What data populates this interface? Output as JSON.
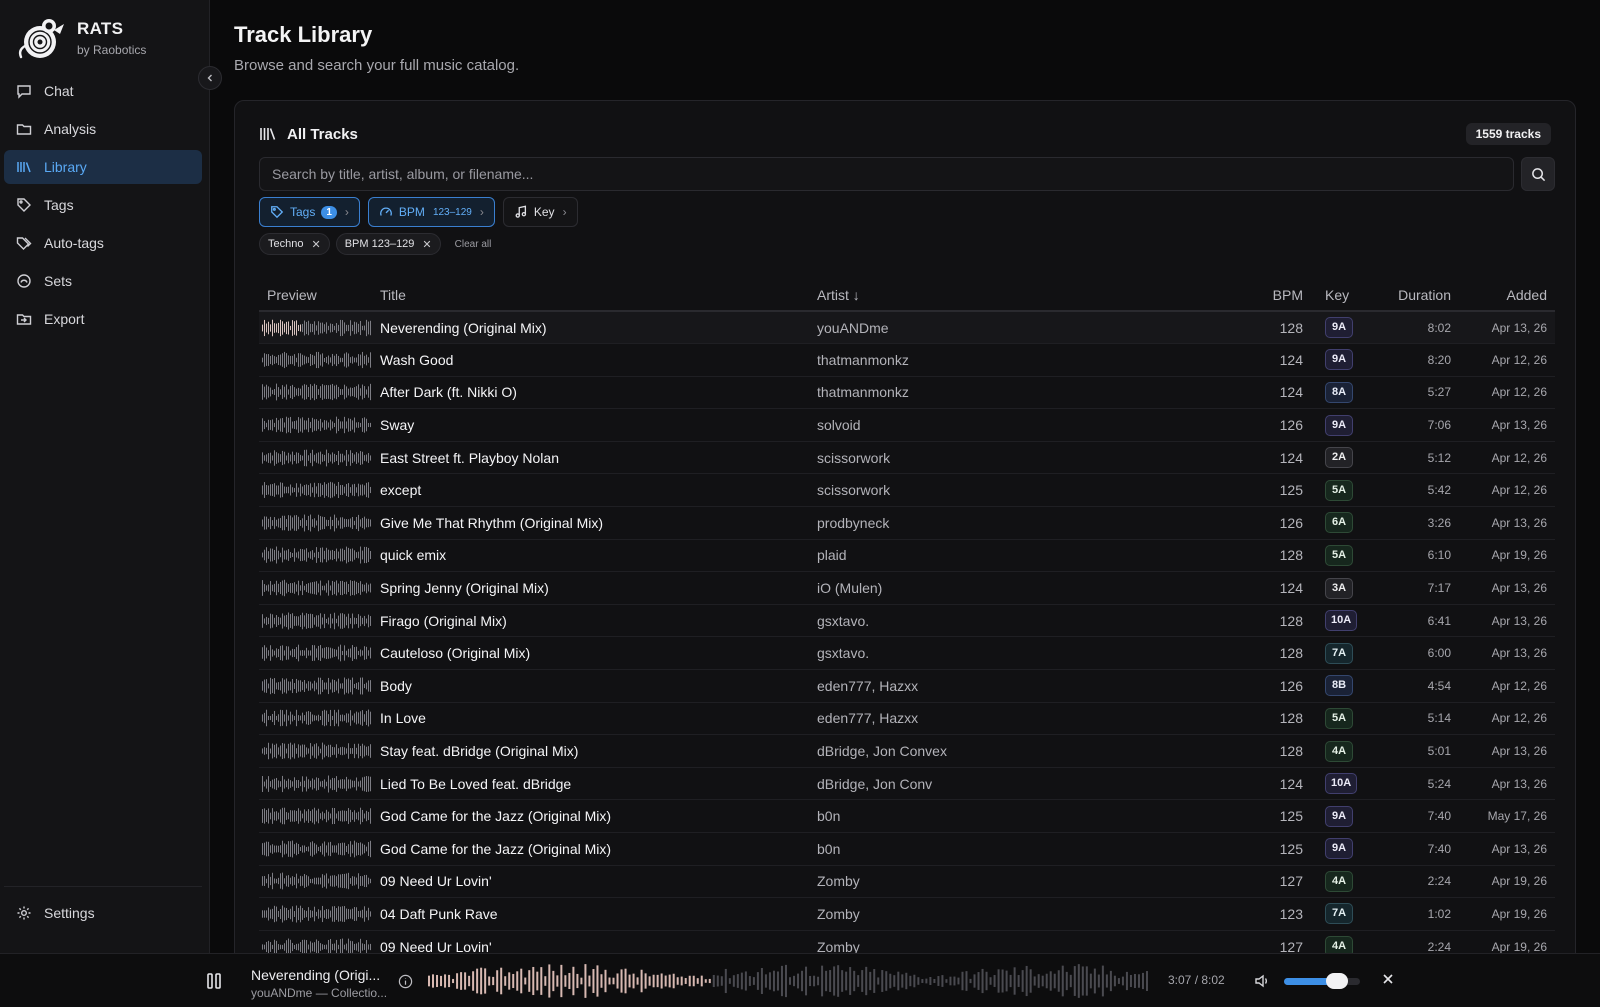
{
  "brand": {
    "name": "RATS",
    "sub": "by Raobotics"
  },
  "nav": [
    {
      "label": "Chat",
      "icon": "chat-icon",
      "active": false
    },
    {
      "label": "Analysis",
      "icon": "folder-icon",
      "active": false
    },
    {
      "label": "Library",
      "icon": "library-icon",
      "active": true
    },
    {
      "label": "Tags",
      "icon": "tag-icon",
      "active": false
    },
    {
      "label": "Auto-tags",
      "icon": "tags-icon",
      "active": false
    },
    {
      "label": "Sets",
      "icon": "sets-icon",
      "active": false
    },
    {
      "label": "Export",
      "icon": "export-icon",
      "active": false
    }
  ],
  "settings": {
    "label": "Settings",
    "icon": "gear-icon"
  },
  "page": {
    "title": "Track Library",
    "subtitle": "Browse and search your full music catalog."
  },
  "card": {
    "title": "All Tracks",
    "count": "1559 tracks",
    "search_placeholder": "Search by title, artist, album, or filename..."
  },
  "filters": {
    "tags": {
      "label": "Tags",
      "count": "1"
    },
    "bpm": {
      "label": "BPM",
      "range": "123–129"
    },
    "key": {
      "label": "Key"
    }
  },
  "chips": {
    "tag": "Techno",
    "bpm": "BPM 123–129",
    "clear": "Clear all"
  },
  "columns": {
    "preview": "Preview",
    "title": "Title",
    "artist": "Artist",
    "sort_indicator": "↓",
    "bpm": "BPM",
    "key": "Key",
    "duration": "Duration",
    "added": "Added"
  },
  "rows": [
    {
      "title": "Neverending (Original Mix)",
      "artist": "youANDme",
      "bpm": "128",
      "key": "9A",
      "duration": "8:02",
      "added": "Apr 13, 26"
    },
    {
      "title": "Wash Good",
      "artist": "thatmanmonkz",
      "bpm": "124",
      "key": "9A",
      "duration": "8:20",
      "added": "Apr 12, 26"
    },
    {
      "title": "After Dark (ft. Nikki O)",
      "artist": "thatmanmonkz",
      "bpm": "124",
      "key": "8A",
      "duration": "5:27",
      "added": "Apr 12, 26"
    },
    {
      "title": "Sway",
      "artist": "solvoid",
      "bpm": "126",
      "key": "9A",
      "duration": "7:06",
      "added": "Apr 13, 26"
    },
    {
      "title": "East Street ft. Playboy Nolan",
      "artist": "scissorwork",
      "bpm": "124",
      "key": "2A",
      "duration": "5:12",
      "added": "Apr 12, 26"
    },
    {
      "title": "except",
      "artist": "scissorwork",
      "bpm": "125",
      "key": "5A",
      "duration": "5:42",
      "added": "Apr 12, 26"
    },
    {
      "title": "Give Me That Rhythm (Original Mix)",
      "artist": "prodbyneck",
      "bpm": "126",
      "key": "6A",
      "duration": "3:26",
      "added": "Apr 13, 26"
    },
    {
      "title": "quick emix",
      "artist": "plaid",
      "bpm": "128",
      "key": "5A",
      "duration": "6:10",
      "added": "Apr 19, 26"
    },
    {
      "title": "Spring Jenny (Original Mix)",
      "artist": "iO (Mulen)",
      "bpm": "124",
      "key": "3A",
      "duration": "7:17",
      "added": "Apr 13, 26"
    },
    {
      "title": "Firago (Original Mix)",
      "artist": "gsxtavo.",
      "bpm": "128",
      "key": "10A",
      "duration": "6:41",
      "added": "Apr 13, 26"
    },
    {
      "title": "Cauteloso (Original Mix)",
      "artist": "gsxtavo.",
      "bpm": "128",
      "key": "7A",
      "duration": "6:00",
      "added": "Apr 13, 26"
    },
    {
      "title": "Body",
      "artist": "eden777, Hazxx",
      "bpm": "126",
      "key": "8B",
      "duration": "4:54",
      "added": "Apr 12, 26"
    },
    {
      "title": "In Love",
      "artist": "eden777, Hazxx",
      "bpm": "128",
      "key": "5A",
      "duration": "5:14",
      "added": "Apr 12, 26"
    },
    {
      "title": "Stay feat. dBridge (Original Mix)",
      "artist": "dBridge, Jon Convex",
      "bpm": "128",
      "key": "4A",
      "duration": "5:01",
      "added": "Apr 13, 26"
    },
    {
      "title": "Lied To Be Loved feat. dBridge",
      "artist": "dBridge, Jon Conv",
      "bpm": "124",
      "key": "10A",
      "duration": "5:24",
      "added": "Apr 13, 26"
    },
    {
      "title": "God Came for the Jazz (Original Mix)",
      "artist": "b0n",
      "bpm": "125",
      "key": "9A",
      "duration": "7:40",
      "added": "May 17, 26"
    },
    {
      "title": "God Came for the Jazz (Original Mix)",
      "artist": "b0n",
      "bpm": "125",
      "key": "9A",
      "duration": "7:40",
      "added": "Apr 13, 26"
    },
    {
      "title": "09 Need Ur Lovin'",
      "artist": "Zomby",
      "bpm": "127",
      "key": "4A",
      "duration": "2:24",
      "added": "Apr 19, 26"
    },
    {
      "title": "04 Daft Punk Rave",
      "artist": "Zomby",
      "bpm": "123",
      "key": "7A",
      "duration": "1:02",
      "added": "Apr 19, 26"
    },
    {
      "title": "09 Need Ur Lovin'",
      "artist": "Zomby",
      "bpm": "127",
      "key": "4A",
      "duration": "2:24",
      "added": "Apr 19, 26"
    }
  ],
  "key_colors": {
    "A-blue": {
      "bg": "#1a2236",
      "border": "#34476e",
      "text": "#e8ecf7"
    },
    "A-green": {
      "bg": "#16271d",
      "border": "#2e4a36",
      "text": "#e4f0e6"
    },
    "A-gray": {
      "bg": "#222226",
      "border": "#45454b",
      "text": "#eeeeef"
    },
    "A-teal": {
      "bg": "#15262c",
      "border": "#2e4d57",
      "text": "#e4eff2"
    },
    "A-purple": {
      "bg": "#1f1e33",
      "border": "#413f6e",
      "text": "#ebeaf7"
    }
  },
  "player": {
    "title": "Neverending (Origi...",
    "subtitle": "youANDme — Collectio...",
    "time": "3:07 / 8:02",
    "progress": 0.39,
    "volume": 0.7
  },
  "accent": "#3d8fe6"
}
